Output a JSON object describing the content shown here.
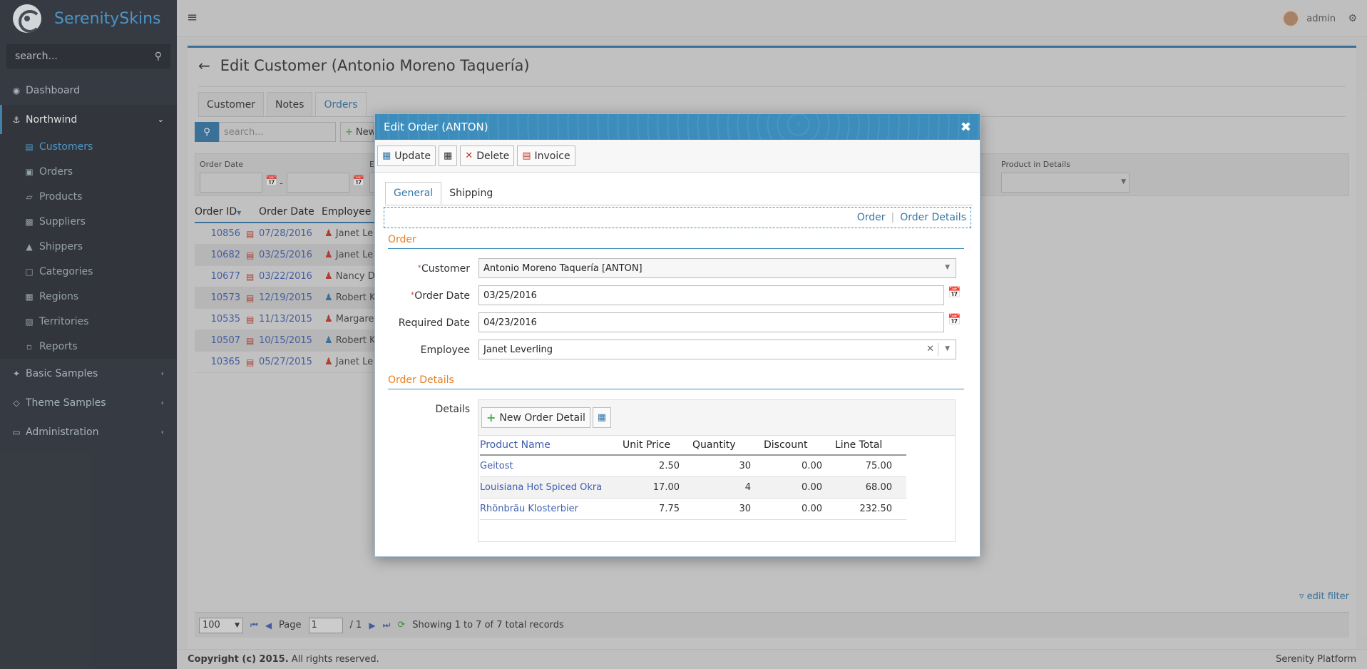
{
  "app": {
    "name": "SerenitySkins"
  },
  "sidebar": {
    "search_placeholder": "search...",
    "items": [
      {
        "label": "Dashboard",
        "icon": "dashboard-icon"
      },
      {
        "label": "Northwind",
        "icon": "anchor-icon"
      },
      {
        "label": "Basic Samples",
        "icon": "magic-wand-icon"
      },
      {
        "label": "Theme Samples",
        "icon": "diamond-icon"
      },
      {
        "label": "Administration",
        "icon": "desktop-icon"
      }
    ],
    "northwind": [
      {
        "label": "Customers",
        "icon": "table-icon"
      },
      {
        "label": "Orders",
        "icon": "cart-icon"
      },
      {
        "label": "Products",
        "icon": "cube-icon"
      },
      {
        "label": "Suppliers",
        "icon": "truck-icon"
      },
      {
        "label": "Shippers",
        "icon": "ship-icon"
      },
      {
        "label": "Categories",
        "icon": "folder-icon"
      },
      {
        "label": "Regions",
        "icon": "map-icon"
      },
      {
        "label": "Territories",
        "icon": "sitemap-icon"
      },
      {
        "label": "Reports",
        "icon": "reports-icon"
      }
    ]
  },
  "topbar": {
    "user": "admin"
  },
  "page": {
    "title": "Edit Customer (Antonio Moreno Taquería)",
    "tabs": [
      "Customer",
      "Notes",
      "Orders"
    ],
    "grid_search_placeholder": "search...",
    "new_button": "New",
    "filters": {
      "order_date": "Order Date",
      "employee_partial": "En",
      "product_in_details": "Product in Details",
      "date_sep": "-"
    },
    "grid": {
      "headers": [
        "Order ID",
        "Order Date",
        "Employee"
      ],
      "rows": [
        {
          "id": "10856",
          "date": "07/28/2016",
          "emp": "Janet Le"
        },
        {
          "id": "10682",
          "date": "03/25/2016",
          "emp": "Janet Le"
        },
        {
          "id": "10677",
          "date": "03/22/2016",
          "emp": "Nancy D"
        },
        {
          "id": "10573",
          "date": "12/19/2015",
          "emp": "Robert K"
        },
        {
          "id": "10535",
          "date": "11/13/2015",
          "emp": "Margare"
        },
        {
          "id": "10507",
          "date": "10/15/2015",
          "emp": "Robert K"
        },
        {
          "id": "10365",
          "date": "05/27/2015",
          "emp": "Janet Le"
        }
      ]
    },
    "pager": {
      "page_size": "100",
      "page_label": "Page",
      "page": "1",
      "of": "/ 1",
      "status": "Showing 1 to 7 of 7 total records"
    },
    "edit_filter": "edit filter"
  },
  "footer": {
    "copyright": "Copyright (c) 2015.",
    "rights": "All rights reserved.",
    "platform": "Serenity Platform"
  },
  "dialog": {
    "title": "Edit Order (ANTON)",
    "toolbar": {
      "update": "Update",
      "delete": "Delete",
      "invoice": "Invoice"
    },
    "tabs": [
      "General",
      "Shipping"
    ],
    "category_links": [
      "Order",
      "Order Details"
    ],
    "cat_order": "Order",
    "cat_details": "Order Details",
    "fields": {
      "customer": {
        "label": "Customer",
        "value": "Antonio Moreno Taquería [ANTON]"
      },
      "order_date": {
        "label": "Order Date",
        "value": "03/25/2016"
      },
      "required_date": {
        "label": "Required Date",
        "value": "04/23/2016"
      },
      "employee": {
        "label": "Employee",
        "value": "Janet Leverling"
      }
    },
    "details": {
      "label": "Details",
      "new_button": "New Order Detail",
      "headers": [
        "Product Name",
        "Unit Price",
        "Quantity",
        "Discount",
        "Line Total"
      ],
      "rows": [
        {
          "name": "Geitost",
          "price": "2.50",
          "qty": "30",
          "disc": "0.00",
          "total": "75.00"
        },
        {
          "name": "Louisiana Hot Spiced Okra",
          "price": "17.00",
          "qty": "4",
          "disc": "0.00",
          "total": "68.00"
        },
        {
          "name": "Rhönbräu Klosterbier",
          "price": "7.75",
          "qty": "30",
          "disc": "0.00",
          "total": "232.50"
        }
      ]
    }
  }
}
